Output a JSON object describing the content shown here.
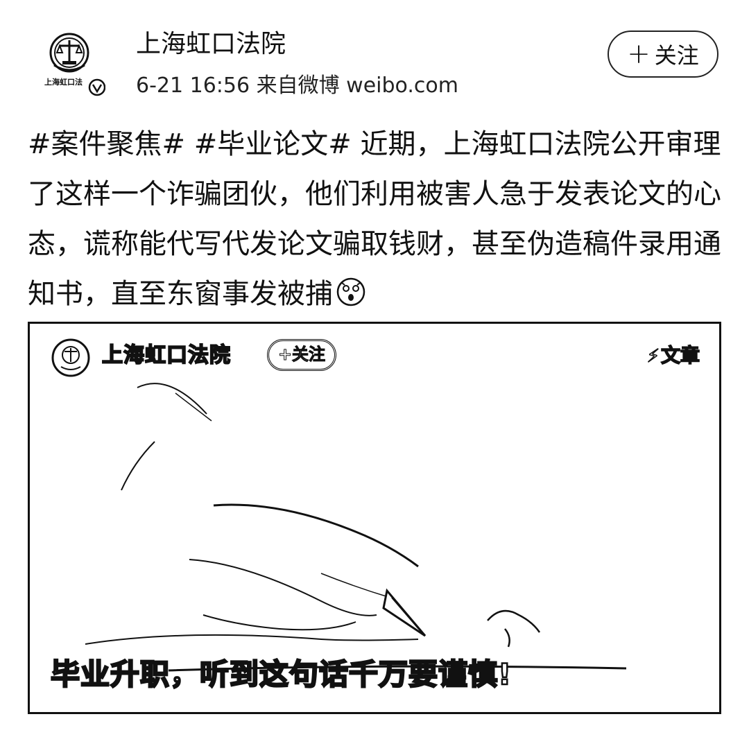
{
  "post": {
    "author": "上海虹口法院",
    "timestamp": "6-21 16:56",
    "source": "来自微博 weibo.com",
    "follow_label": "关注",
    "avatar_caption": "上海虹口法",
    "text": "#案件聚焦# #毕业论文# 近期，上海虹口法院公开审理了这样一个诈骗团伙，他们利用被害人急于发表论文的心态，谎称能代写代发论文骗取钱财，甚至伪造稿件录用通知书，直至东窗事发被捕",
    "emoji": "surprised-face-icon"
  },
  "media": {
    "account_name": "上海虹口法院",
    "follow_label": "+关注",
    "tag_label": "文章",
    "caption": "毕业升职，听到这句话千万要谨慎!"
  },
  "colors": {
    "ink": "#111111",
    "background": "#ffffff"
  }
}
